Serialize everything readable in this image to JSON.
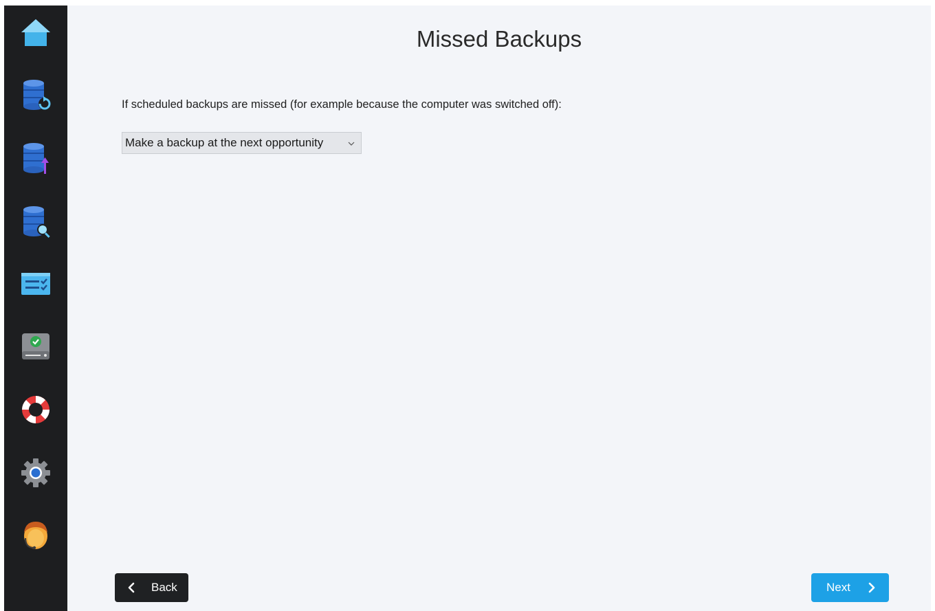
{
  "sidebar": {
    "items": [
      {
        "icon": "home-icon"
      },
      {
        "icon": "database-refresh-icon"
      },
      {
        "icon": "database-upload-icon"
      },
      {
        "icon": "database-search-icon"
      },
      {
        "icon": "task-list-icon"
      },
      {
        "icon": "drive-check-icon"
      },
      {
        "icon": "lifebuoy-icon"
      },
      {
        "icon": "gear-icon"
      },
      {
        "icon": "support-agent-icon"
      }
    ]
  },
  "main": {
    "title": "Missed Backups",
    "description": "If scheduled backups are missed (for example because the computer was switched off):",
    "missed_backup_option": {
      "selected": "Make a backup at the next opportunity"
    }
  },
  "footer": {
    "back_label": "Back",
    "next_label": "Next"
  },
  "colors": {
    "sidebar_bg": "#1d1e20",
    "content_bg": "#f3f5f9",
    "next_button": "#1da1e6",
    "back_button": "#1f2123"
  }
}
